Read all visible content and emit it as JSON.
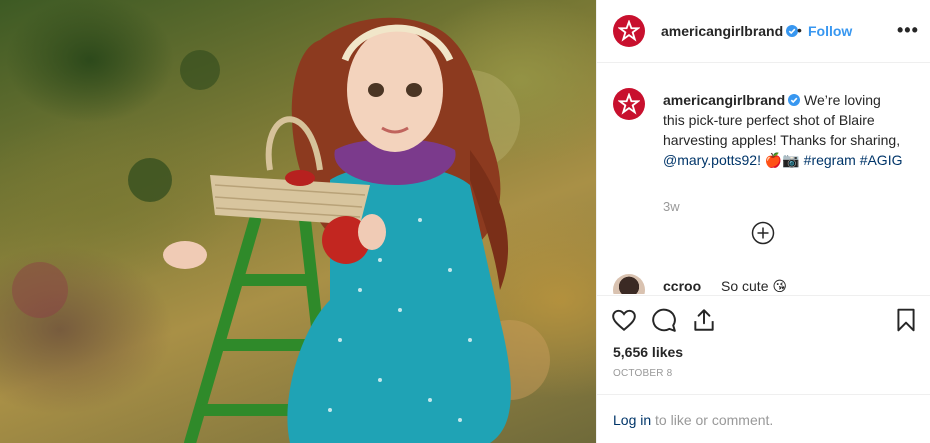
{
  "post": {
    "image_alt": "American Girl doll Blaire on a green ladder holding an apple basket",
    "author": "americangirlbrand",
    "follow_label": "Follow",
    "dot": "•",
    "more_label": "•••"
  },
  "caption": {
    "author": "americangirlbrand",
    "text_1": "We’re loving this pick-ture perfect shot of Blaire harvesting apples! Thanks for sharing,",
    "mention": "@mary.potts92!",
    "emoji": "🍎📷",
    "hashtag_1": "#regram",
    "hashtag_2": "#AGIG",
    "time": "3w"
  },
  "comment": {
    "user": "ccroo",
    "text": "So cute 😘"
  },
  "stats": {
    "likes": "5,656 likes",
    "date": "OCTOBER 8"
  },
  "login": {
    "link_label": "Log in",
    "rest": " to like or comment."
  },
  "colors": {
    "brand": "#c8102e",
    "follow": "#3897f0",
    "link": "#003569"
  }
}
